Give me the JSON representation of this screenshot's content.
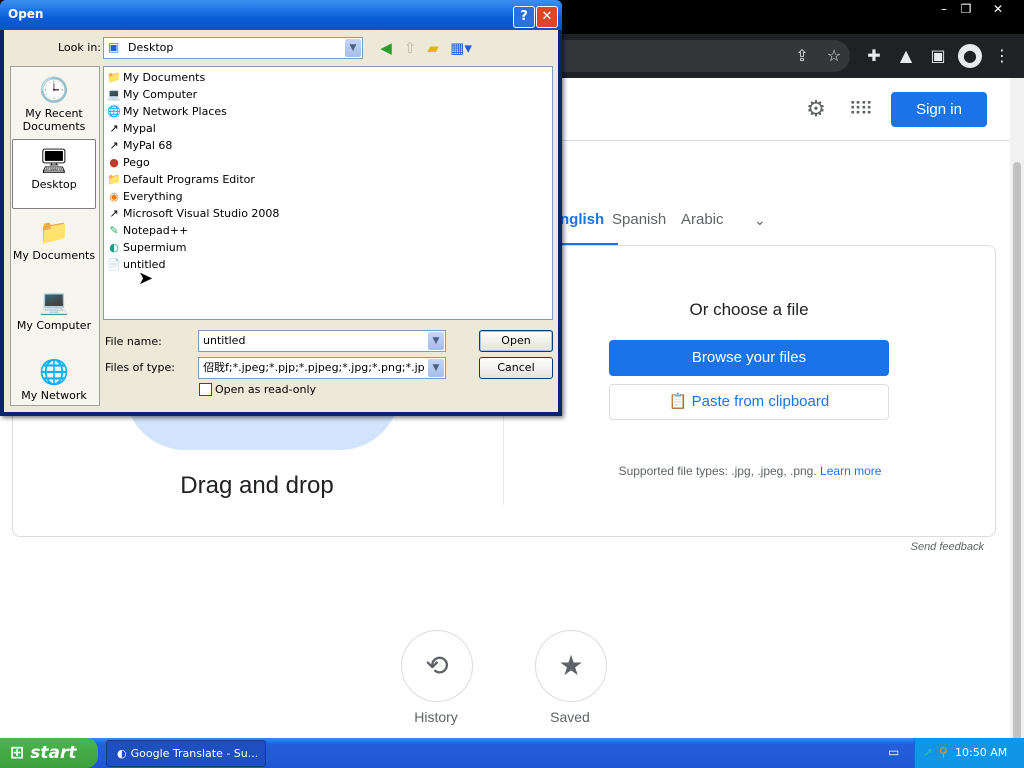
{
  "browser": {
    "window_controls": [
      "–",
      "❐",
      "✕"
    ],
    "toolbar_icons": [
      "share-icon",
      "star-icon",
      "extensions-icon",
      "flask-icon",
      "sidebar-icon",
      "profile-icon",
      "menu-icon"
    ]
  },
  "page": {
    "signin_label": "Sign in",
    "lang_tabs": [
      "nglish",
      "Spanish",
      "Arabic"
    ],
    "lang_more": "⌄",
    "drag_drop": "Drag and drop",
    "choose_file": "Or choose a file",
    "browse_label": "Browse your files",
    "paste_label": "Paste from clipboard",
    "supported_text": "Supported file types: .jpg, .jpeg, .png.",
    "learn_more": "Learn more",
    "send_feedback": "Send feedback",
    "history_label": "History",
    "saved_label": "Saved",
    "accent_color": "#1a73e8"
  },
  "dialog": {
    "title": "Open",
    "look_in_label": "Look in:",
    "look_in_value": "Desktop",
    "places": [
      "My Recent Documents",
      "Desktop",
      "My Documents",
      "My Computer",
      "My Network"
    ],
    "files": [
      {
        "name": "My Documents",
        "icon": "folder-docs-icon"
      },
      {
        "name": "My Computer",
        "icon": "computer-icon"
      },
      {
        "name": "My Network Places",
        "icon": "network-icon"
      },
      {
        "name": "Mypal",
        "icon": "shortcut-icon"
      },
      {
        "name": "MyPal 68",
        "icon": "shortcut-icon"
      },
      {
        "name": "Pego",
        "icon": "pego-icon"
      },
      {
        "name": "Default Programs Editor",
        "icon": "folder-icon"
      },
      {
        "name": "Everything",
        "icon": "search-app-icon"
      },
      {
        "name": "Microsoft Visual Studio 2008",
        "icon": "shortcut-icon"
      },
      {
        "name": "Notepad++",
        "icon": "notepad-icon"
      },
      {
        "name": "Supermium",
        "icon": "browser-icon"
      },
      {
        "name": "untitled",
        "icon": "file-icon"
      }
    ],
    "file_name_label": "File name:",
    "file_name_value": "untitled",
    "file_type_label": "Files of type:",
    "file_type_value": "佋聀f;*.jpeg;*.pjp;*.pjpeg;*.jpg;*.png;*.jpeg;*.jpg",
    "open_label": "Open",
    "cancel_label": "Cancel",
    "readonly_label": "Open as read-only"
  },
  "taskbar": {
    "start_label": "start",
    "task_label": "Google Translate - Su...",
    "clock": "10:50 AM"
  }
}
